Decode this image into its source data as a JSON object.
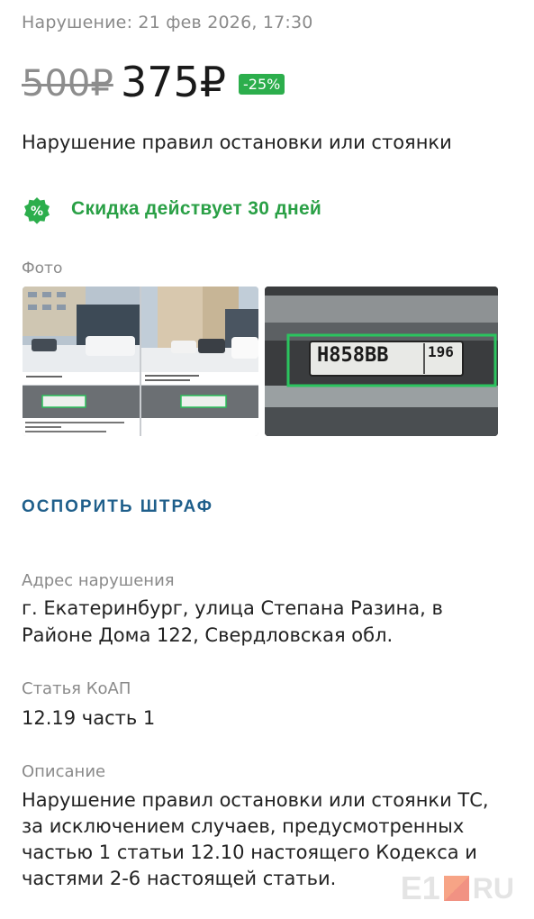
{
  "violation_datetime": "Нарушение: 21 фев 2026, 17:30",
  "price": {
    "old": "500₽",
    "new": "375₽",
    "discount": "-25%"
  },
  "title": "Нарушение правил остановки или стоянки",
  "promo": {
    "icon": "percent-badge-icon",
    "text": "Скидка действует 30 дней"
  },
  "photos": {
    "label": "Фото",
    "plate_text": "Н858ВВ",
    "plate_region": "196"
  },
  "dispute_label": "ОСПОРИТЬ ШТРАФ",
  "address": {
    "label": "Адрес нарушения",
    "value": "г. Екатеринбург, улица Степана Разина, в Районе Дома 122, Свердловская обл."
  },
  "article": {
    "label": "Статья КоАП",
    "value": "12.19 часть 1"
  },
  "description": {
    "label": "Описание",
    "value": "Нарушение правил остановки или стоянки ТС, за исключением случаев, предусмотренных частью 1 статьи 12.10 настоящего Кодекса и частями 2-6 настоящей статьи."
  },
  "watermark": "E1.RU",
  "colors": {
    "green": "#2cae4c",
    "link": "#1f5f8b",
    "muted": "#8a8a8a"
  }
}
